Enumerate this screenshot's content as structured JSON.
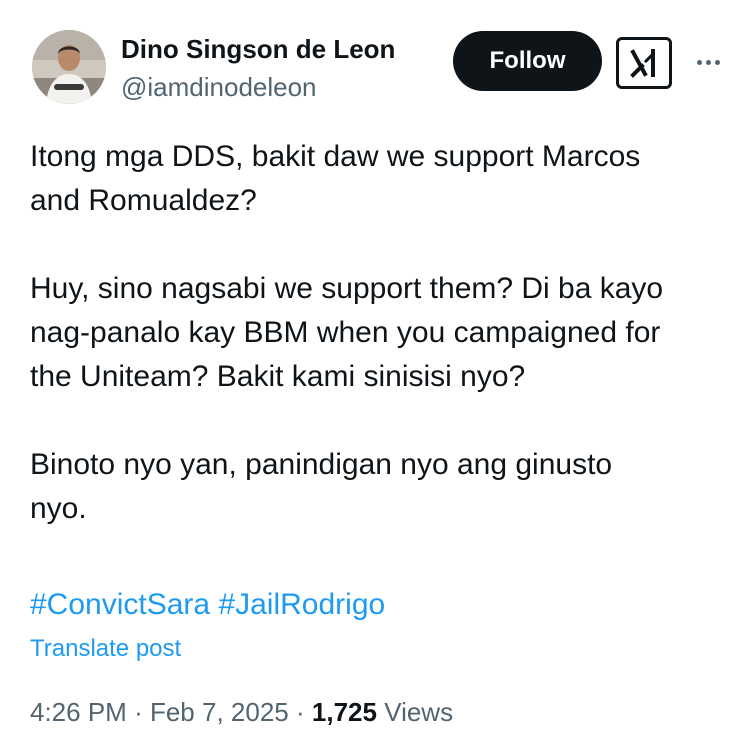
{
  "author": {
    "display_name": "Dino Singson de Leon",
    "handle": "@iamdinodeleon"
  },
  "actions": {
    "follow_label": "Follow",
    "grok_icon": "grok-icon",
    "more_icon": "more-icon"
  },
  "post": {
    "paragraphs": [
      [
        "Itong mga DDS, bakit daw we support Marcos",
        "and Romualdez?"
      ],
      [
        "Huy, sino nagsabi we support them? Di ba kayo",
        "nag-panalo kay BBM when you campaigned for",
        "the Uniteam? Bakit kami sinisisi nyo?"
      ],
      [
        "Binoto nyo yan, panindigan nyo ang ginusto",
        "nyo."
      ]
    ],
    "hashtags": [
      "#ConvictSara",
      "#JailRodrigo"
    ],
    "translate_label": "Translate post"
  },
  "meta": {
    "time": "4:26 PM",
    "date": "Feb 7, 2025",
    "separator": "·",
    "views_count": "1,725",
    "views_label": "Views"
  },
  "colors": {
    "text": "#0f1419",
    "secondary": "#536471",
    "link": "#1d9bf0",
    "follow_bg": "#0f1419"
  }
}
